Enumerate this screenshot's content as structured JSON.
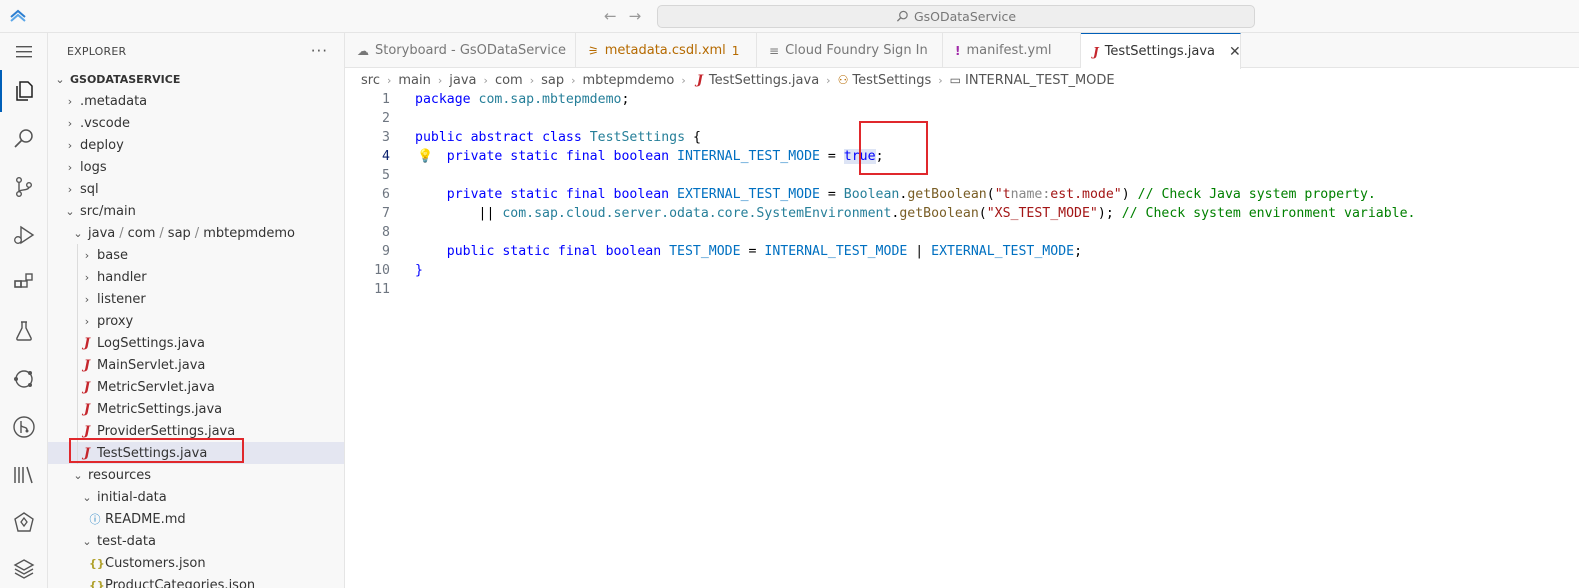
{
  "titlebar": {
    "search_text": "GsODataService",
    "back_glyph": "←",
    "forward_glyph": "→"
  },
  "activity_bar": {
    "items": [
      "menu-icon",
      "files-icon",
      "search-icon",
      "source-control-icon",
      "run-debug-icon",
      "extensions-icon",
      "testing-icon",
      "remote-icon",
      "git-graph-icon",
      "library-icon",
      "gem-icon",
      "layers-icon"
    ]
  },
  "sidebar": {
    "title": "EXPLORER",
    "more": "···",
    "root": "GSODATASERVICE",
    "items": [
      {
        "label": ".metadata"
      },
      {
        "label": ".vscode"
      },
      {
        "label": "deploy"
      },
      {
        "label": "logs"
      },
      {
        "label": "sql"
      },
      {
        "label": "src/main"
      },
      {
        "label_parts": [
          "java",
          "com",
          "sap",
          "mbtepmdemo"
        ]
      },
      {
        "label": "base"
      },
      {
        "label": "handler"
      },
      {
        "label": "listener"
      },
      {
        "label": "proxy"
      },
      {
        "label": "LogSettings.java"
      },
      {
        "label": "MainServlet.java"
      },
      {
        "label": "MetricServlet.java"
      },
      {
        "label": "MetricSettings.java"
      },
      {
        "label": "ProviderSettings.java"
      },
      {
        "label": "TestSettings.java"
      },
      {
        "label": "resources"
      },
      {
        "label": "initial-data"
      },
      {
        "label": "README.md"
      },
      {
        "label": "test-data"
      },
      {
        "label": "Customers.json"
      },
      {
        "label": "ProductCategories.json"
      }
    ]
  },
  "tabs": [
    {
      "label": "Storyboard - GsODataService",
      "icon": "☁"
    },
    {
      "label": "metadata.csdl.xml",
      "icon": "⚞",
      "badge": "1"
    },
    {
      "label": "Cloud Foundry Sign In",
      "icon": "≡"
    },
    {
      "label": "manifest.yml",
      "icon": "!"
    },
    {
      "label": "TestSettings.java",
      "icon": "J",
      "close": "✕"
    }
  ],
  "breadcrumb": [
    "src",
    "main",
    "java",
    "com",
    "sap",
    "mbtepmdemo",
    "TestSettings.java",
    "TestSettings",
    "INTERNAL_TEST_MODE"
  ],
  "editor": {
    "line_numbers": [
      "1",
      "2",
      "3",
      "4",
      "5",
      "6",
      "7",
      "8",
      "9",
      "10",
      "11"
    ],
    "line1": {
      "kw": "package",
      "pkg": "com.sap.mbtepmdemo",
      "end": ";"
    },
    "line3": {
      "kw1": "public",
      "kw2": "abstract",
      "kw3": "class",
      "cls": "TestSettings",
      "end": " {"
    },
    "line4": {
      "mods": "private static final",
      "type": "boolean",
      "ident": "INTERNAL_TEST_MODE",
      "eq": " = ",
      "val": "true",
      "end": ";"
    },
    "line6": {
      "mods": "private static final",
      "type": "boolean",
      "ident": "EXTERNAL_TEST_MODE",
      "eq": " = ",
      "cls": "Boolean",
      "dot": ".",
      "fn": "getBoolean",
      "open": "(",
      "str_a": "\"t",
      "hint": "name:",
      "str_b": "est.mode\"",
      "close": ")",
      "cmt": " // Check Java system property."
    },
    "line7": {
      "op": "|| ",
      "pkg": "com.sap.cloud.server.odata.core.SystemEnvironment",
      "dot": ".",
      "fn": "getBoolean",
      "open": "(",
      "str": "\"XS_TEST_MODE\"",
      "close": ");",
      "cmt": " // Check system environment variable."
    },
    "line9": {
      "mods": "public static final",
      "type": "boolean",
      "ident": "TEST_MODE",
      "eq": " = ",
      "a": "INTERNAL_TEST_MODE",
      "op": " | ",
      "b": "EXTERNAL_TEST_MODE",
      "end": ";"
    },
    "line10": {
      "text": "}"
    }
  },
  "colors": {
    "accent": "#005fb8",
    "highlight_box": "#e0282c",
    "java_icon": "#c5262d"
  }
}
